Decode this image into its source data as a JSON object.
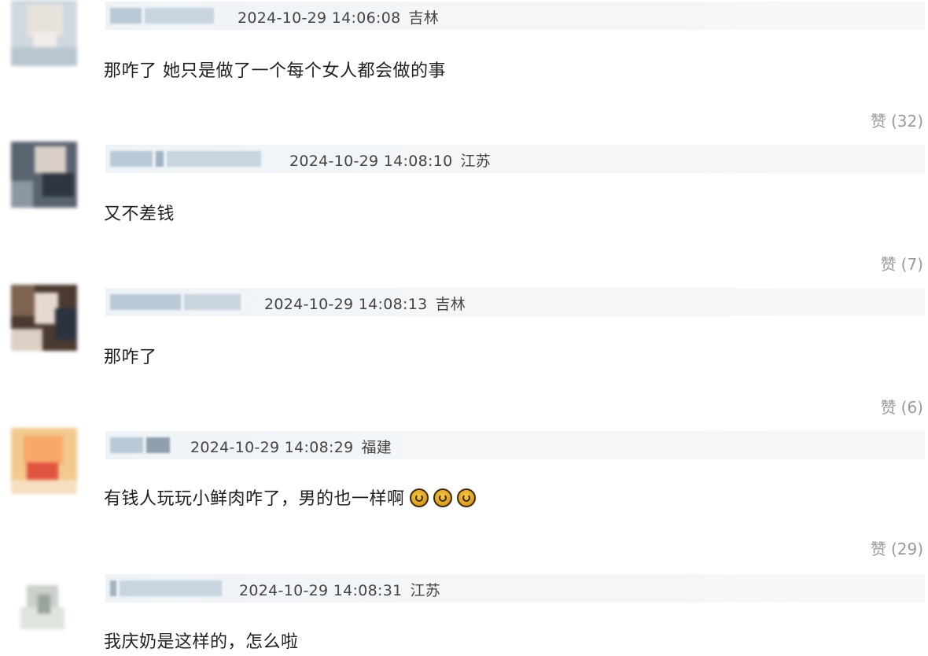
{
  "comments": [
    {
      "time": "2024-10-29 14:06:08",
      "location": "吉林",
      "text": "那咋了 她只是做了一个每个女人都会做的事",
      "like_label": "赞",
      "like_count": "(32)",
      "emojis": []
    },
    {
      "time": "2024-10-29 14:08:10",
      "location": "江苏",
      "text": "又不差钱",
      "like_label": "赞",
      "like_count": "(7)",
      "emojis": []
    },
    {
      "time": "2024-10-29 14:08:13",
      "location": "吉林",
      "text": "那咋了",
      "like_label": "赞",
      "like_count": "(6)",
      "emojis": []
    },
    {
      "time": "2024-10-29 14:08:29",
      "location": "福建",
      "text": "有钱人玩玩小鲜肉咋了，男的也一样啊",
      "like_label": "赞",
      "like_count": "(29)",
      "emojis": [
        "grin-emoji",
        "grin-emoji",
        "grin-emoji"
      ]
    },
    {
      "time": "2024-10-29 14:08:31",
      "location": "江苏",
      "text": "我庆奶是这样的，怎么啦",
      "like_label": "",
      "like_count": "",
      "emojis": []
    }
  ],
  "colors": {
    "header_bar": "#eef3f7",
    "meta_text": "#444444",
    "like_text": "#9a9a9a"
  }
}
